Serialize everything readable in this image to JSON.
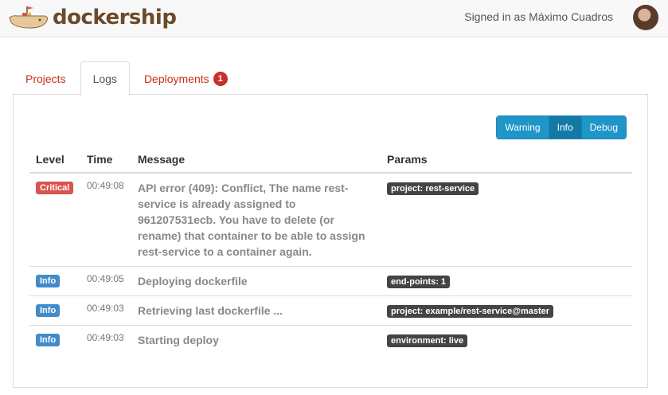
{
  "app": {
    "brand": "dockership",
    "signed_in": "Signed in as Máximo Cuadros"
  },
  "tabs": [
    {
      "label": "Projects",
      "active": false
    },
    {
      "label": "Logs",
      "active": true
    },
    {
      "label": "Deployments",
      "active": false,
      "badge": "1"
    }
  ],
  "filters": [
    {
      "label": "Warning",
      "active": false
    },
    {
      "label": "Info",
      "active": true
    },
    {
      "label": "Debug",
      "active": false
    }
  ],
  "table": {
    "headers": [
      "Level",
      "Time",
      "Message",
      "Params"
    ],
    "rows": [
      {
        "level": "Critical",
        "time": "00:49:08",
        "message": "API error (409): Conflict, The name rest-service is already assigned to 961207531ecb. You have to delete (or rename) that container to be able to assign rest-service to a container again.",
        "param": "project: rest-service"
      },
      {
        "level": "Info",
        "time": "00:49:05",
        "message": "Deploying dockerfile",
        "param": "end-points: 1"
      },
      {
        "level": "Info",
        "time": "00:49:03",
        "message": "Retrieving last dockerfile ...",
        "param": "project: example/rest-service@master"
      },
      {
        "level": "Info",
        "time": "00:49:03",
        "message": "Starting deploy",
        "param": "environment: live"
      }
    ]
  },
  "colors": {
    "tab_link": "#c7301a",
    "critical": "#d9534f",
    "info": "#428bca",
    "filter_button": "#1f96c8",
    "brand": "#6b4a2b"
  }
}
